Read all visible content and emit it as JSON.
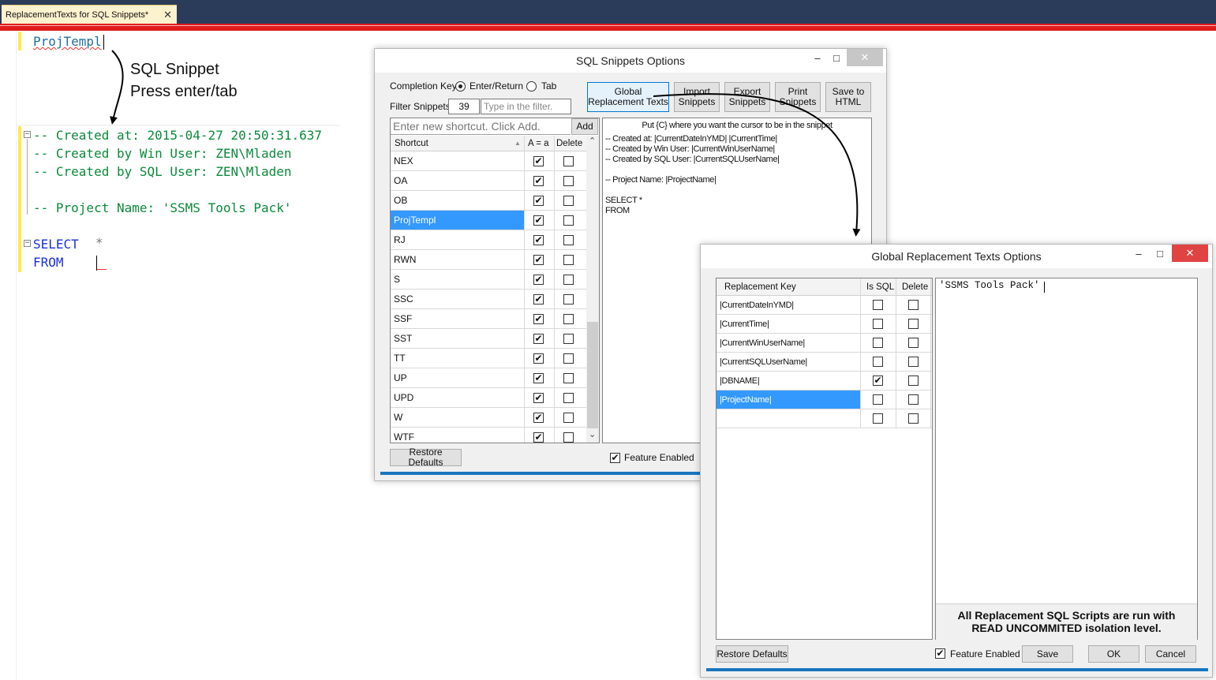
{
  "ide": {
    "tab_title": "ReplacementTexts for SQL Snippets*",
    "tab_close": "✕",
    "editor": {
      "typed_shortcut": "ProjTempl",
      "line_created_at": "-- Created at: 2015-04-27 20:50:31.637",
      "line_created_by_win": "-- Created by Win User: ZEN\\Mladen",
      "line_created_by_sql": "-- Created by SQL User: ZEN\\Mladen",
      "line_project_prefix": "-- Project Name: ",
      "line_project_value": "'SSMS Tools Pack'",
      "select_kw": "SELECT",
      "select_star": "*",
      "from_kw": "FROM"
    },
    "annotation_line1": "SQL Snippet",
    "annotation_line2": "Press enter/tab",
    "fold_minus": "−"
  },
  "snippets_dialog": {
    "title": "SQL Snippets Options",
    "minimize": "–",
    "maximize": "□",
    "close": "✕",
    "completion_key_label": "Completion Key:",
    "option_enter": "Enter/Return",
    "option_tab": "Tab",
    "filter_label": "Filter Snippets",
    "filter_count": "39",
    "filter_placeholder": "Type in the filter.",
    "btn_global": "Global Replacement Texts",
    "btn_import": "Import Snippets",
    "btn_export": "Export Snippets",
    "btn_print": "Print Snippets",
    "btn_save_html": "Save to HTML",
    "new_shortcut_placeholder": "Enter new shortcut. Click Add.",
    "btn_add": "Add",
    "col_shortcut": "Shortcut",
    "col_case": "A = a",
    "col_delete": "Delete",
    "sort_arrow": "▲",
    "rows": [
      {
        "key": "NEX",
        "case": "✔",
        "del": ""
      },
      {
        "key": "OA",
        "case": "✔",
        "del": ""
      },
      {
        "key": "OB",
        "case": "✔",
        "del": ""
      },
      {
        "key": "ProjTempl",
        "case": "✔",
        "del": ""
      },
      {
        "key": "RJ",
        "case": "✔",
        "del": ""
      },
      {
        "key": "RWN",
        "case": "✔",
        "del": ""
      },
      {
        "key": "S",
        "case": "✔",
        "del": ""
      },
      {
        "key": "SSC",
        "case": "✔",
        "del": ""
      },
      {
        "key": "SSF",
        "case": "✔",
        "del": ""
      },
      {
        "key": "SST",
        "case": "✔",
        "del": ""
      },
      {
        "key": "TT",
        "case": "✔",
        "del": ""
      },
      {
        "key": "UP",
        "case": "✔",
        "del": ""
      },
      {
        "key": "UPD",
        "case": "✔",
        "del": ""
      },
      {
        "key": "W",
        "case": "✔",
        "del": ""
      },
      {
        "key": "WTF",
        "case": "✔",
        "del": ""
      }
    ],
    "selected_row": "ProjTempl",
    "scroll_up": "⌃",
    "scroll_down": "⌄",
    "snippet_hint": "Put {C} where you want the cursor to be in the snippet",
    "snippet_lines": [
      "-- Created at: |CurrentDateInYMD| |CurrentTime|",
      "-- Created by Win User: |CurrentWinUserName|",
      "-- Created by SQL User: |CurrentSQLUserName|",
      "",
      "-- Project Name: |ProjectName|",
      "",
      "SELECT *",
      "FROM"
    ],
    "btn_restore": "Restore Defaults",
    "feature_enabled": "Feature Enabled",
    "feature_check": "✔"
  },
  "global_dialog": {
    "title": "Global Replacement Texts Options",
    "minimize": "–",
    "maximize": "□",
    "close": "✕",
    "col_key": "Replacement Key",
    "col_is_sql": "Is SQL",
    "col_delete": "Delete",
    "rows": [
      {
        "key": "|CurrentDateInYMD|",
        "is_sql": "",
        "del": ""
      },
      {
        "key": "|CurrentTime|",
        "is_sql": "",
        "del": ""
      },
      {
        "key": "|CurrentWinUserName|",
        "is_sql": "",
        "del": ""
      },
      {
        "key": "|CurrentSQLUserName|",
        "is_sql": "",
        "del": ""
      },
      {
        "key": "|DBNAME|",
        "is_sql": "✔",
        "del": ""
      },
      {
        "key": "|ProjectName|",
        "is_sql": "",
        "del": ""
      },
      {
        "key": "",
        "is_sql": "",
        "del": ""
      }
    ],
    "selected_row": "|ProjectName|",
    "value_text": "'SSMS Tools Pack'",
    "notice_line1": "All Replacement SQL Scripts are run with",
    "notice_line2": "READ UNCOMMITED isolation level.",
    "btn_restore": "Restore Defaults",
    "feature_enabled": "Feature Enabled",
    "feature_check": "✔",
    "btn_save": "Save",
    "btn_ok": "OK",
    "btn_cancel": "Cancel"
  },
  "colors": {
    "ide_header": "#2b3b5a",
    "accent_red": "#e01c1c",
    "selection_blue": "#3399ff",
    "comment_green": "#0b8a3a",
    "keyword_blue": "#1a2fe0"
  }
}
